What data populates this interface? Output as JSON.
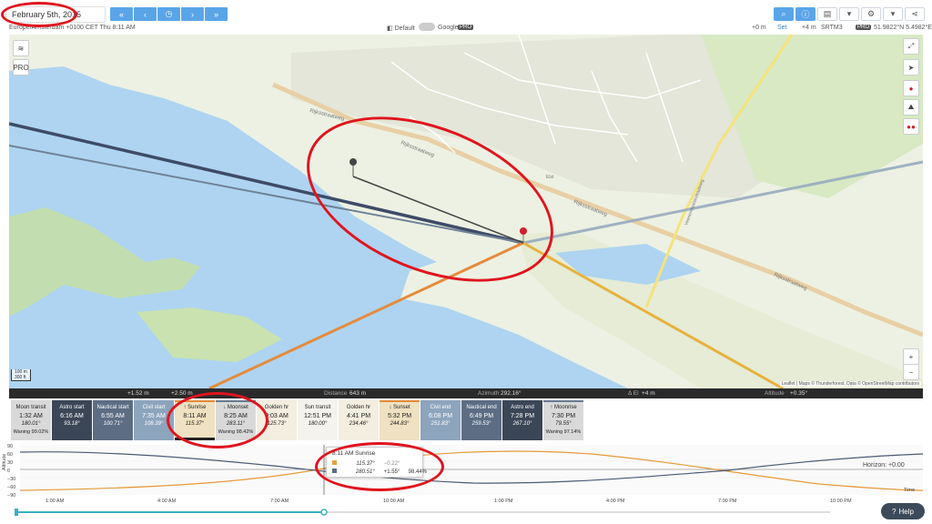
{
  "toolbar": {
    "date": "February 5th, 2015",
    "nav_buttons": [
      "«",
      "‹",
      "◷",
      "›",
      "»"
    ],
    "tools": [
      "⌕",
      "ⓘ",
      "▤",
      "▾",
      "⚙",
      "▾",
      "⋖"
    ]
  },
  "info": {
    "location": "Europe/Amsterdam +0100 CET Thu 8:11 AM",
    "map_default": "Default",
    "map_google": "Google",
    "pro": "PRO",
    "elev_left": "+0 m",
    "set_label": "Set",
    "elev_right": "+4 m",
    "srtm": "SRTM3",
    "coords": "51.9822°N 5.4982°E"
  },
  "map": {
    "streets": [
      "Rijksstraatweg",
      "Kastanjelaan",
      "Vreeswijk",
      "Elst",
      "Veenendaalsestraatweg"
    ],
    "scale_m": "100 m",
    "scale_ft": "300 ft",
    "attribution": "Leaflet | Maps © Thunderforest, Data © OpenStreetMap contributors",
    "zoom_in": "+",
    "zoom_out": "−",
    "pro": "PRO"
  },
  "stats": {
    "h1": "+1.52 m",
    "h2": "+2.50 m",
    "dist_label": "Distance",
    "dist": "643 m",
    "az_label": "Azimuth",
    "az": "292.16°",
    "el_label": "Δ El",
    "el": "+4 m",
    "alt_label": "Altitude",
    "alt": "+0.35°"
  },
  "events": [
    {
      "name": "Moon transit",
      "time": "1:32 AM",
      "angle": "180.01°",
      "extra": "Waning 99.02%",
      "color": "#d9d9d9",
      "text": "#222"
    },
    {
      "name": "Astro start",
      "time": "6:16 AM",
      "angle": "93.18°",
      "extra": "",
      "color": "#3b4656",
      "text": "#fff"
    },
    {
      "name": "Nautical start",
      "time": "6:55 AM",
      "angle": "100.71°",
      "extra": "",
      "color": "#5c6d84",
      "text": "#fff"
    },
    {
      "name": "Civil start",
      "time": "7:35 AM",
      "angle": "108.39°",
      "extra": "",
      "color": "#8da4bd",
      "text": "#fff"
    },
    {
      "name": "↑ Sunrise",
      "time": "8:11 AM",
      "angle": "115.37°",
      "extra": "",
      "color": "#efe1c1",
      "text": "#222"
    },
    {
      "name": "↓ Moonset",
      "time": "8:25 AM",
      "angle": "283.11°",
      "extra": "Waning 98.42%",
      "color": "#d9d9d9",
      "text": "#222"
    },
    {
      "name": "Golden hr",
      "time": "9:03 AM",
      "angle": "125.73°",
      "extra": "",
      "color": "#f3eedf",
      "text": "#222"
    },
    {
      "name": "Sun transit",
      "time": "12:51 PM",
      "angle": "180.00°",
      "extra": "",
      "color": "#f5f3ee",
      "text": "#222"
    },
    {
      "name": "Golden hr",
      "time": "4:41 PM",
      "angle": "234.46°",
      "extra": "",
      "color": "#f3eedf",
      "text": "#222"
    },
    {
      "name": "↓ Sunset",
      "time": "5:32 PM",
      "angle": "244.83°",
      "extra": "",
      "color": "#efe1c1",
      "text": "#222"
    },
    {
      "name": "Civil end",
      "time": "6:08 PM",
      "angle": "251.83°",
      "extra": "",
      "color": "#8da4bd",
      "text": "#fff"
    },
    {
      "name": "Nautical end",
      "time": "6:49 PM",
      "angle": "259.53°",
      "extra": "",
      "color": "#5c6d84",
      "text": "#fff"
    },
    {
      "name": "Astro end",
      "time": "7:28 PM",
      "angle": "267.10°",
      "extra": "",
      "color": "#3b4656",
      "text": "#fff"
    },
    {
      "name": "↑ Moonrise",
      "time": "7:30 PM",
      "angle": "79.55°",
      "extra": "Waning 97.14%",
      "color": "#d9d9d9",
      "text": "#222"
    }
  ],
  "chart": {
    "y_label": "Altitude",
    "y_ticks": [
      "90",
      "60",
      "30",
      "0",
      "−30",
      "−60",
      "−90"
    ],
    "x_ticks": [
      "1:00 AM",
      "4:00 AM",
      "7:00 AM",
      "10:00 AM",
      "1:00 PM",
      "4:00 PM",
      "7:00 PM",
      "10:00 PM"
    ],
    "horizon": "Horizon: +0.00",
    "time_label": "Time"
  },
  "tooltip": {
    "title": "8:11 AM Sunrise",
    "sun_az": "115.37°",
    "sun_alt": "−0.22°",
    "moon_az": "280.51°",
    "moon_alt": "+1.55°",
    "moon_pct": "98.44%",
    "sun_color": "#e8a040",
    "moon_color": "#5b6f86"
  },
  "help": "Help"
}
